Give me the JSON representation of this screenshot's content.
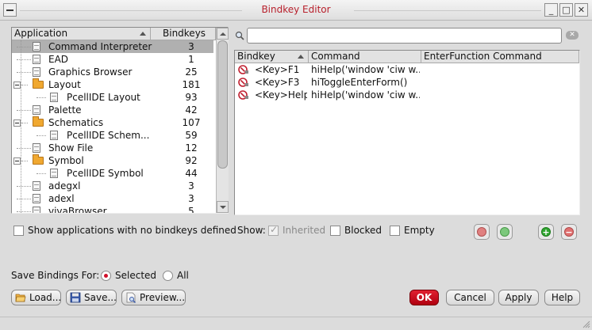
{
  "window": {
    "title": "Bindkey Editor",
    "controls": [
      "_",
      "□",
      "✕"
    ]
  },
  "app_table": {
    "headers": {
      "application": "Application",
      "bindkeys": "Bindkeys"
    },
    "rows": [
      {
        "label": "Command Interpreter",
        "count": "3",
        "type": "doc",
        "level": 0,
        "selected": true
      },
      {
        "label": "EAD",
        "count": "1",
        "type": "doc",
        "level": 0
      },
      {
        "label": "Graphics Browser",
        "count": "25",
        "type": "doc",
        "level": 0
      },
      {
        "label": "Layout",
        "count": "181",
        "type": "folder",
        "level": 0
      },
      {
        "label": "PcellIDE Layout",
        "count": "93",
        "type": "doc",
        "level": 1
      },
      {
        "label": "Palette",
        "count": "42",
        "type": "doc",
        "level": 0
      },
      {
        "label": "Schematics",
        "count": "107",
        "type": "folder",
        "level": 0
      },
      {
        "label": "PcellIDE Schem...",
        "count": "59",
        "type": "doc",
        "level": 1
      },
      {
        "label": "Show File",
        "count": "12",
        "type": "doc",
        "level": 0
      },
      {
        "label": "Symbol",
        "count": "92",
        "type": "folder",
        "level": 0
      },
      {
        "label": "PcellIDE Symbol",
        "count": "44",
        "type": "doc",
        "level": 1
      },
      {
        "label": "adegxl",
        "count": "3",
        "type": "doc",
        "level": 0
      },
      {
        "label": "adexl",
        "count": "3",
        "type": "doc",
        "level": 0
      },
      {
        "label": "vivaBrowser",
        "count": "5",
        "type": "doc",
        "level": 0
      }
    ],
    "show_empty_label": "Show applications with no bindkeys defined"
  },
  "search": {
    "value": "",
    "placeholder": ""
  },
  "binding_table": {
    "headers": {
      "bindkey": "Bindkey",
      "command": "Command",
      "enter_function": "EnterFunction Command"
    },
    "rows": [
      {
        "bindkey": "<Key>F1",
        "command": "hiHelp('window 'ciw w...",
        "enter_function": ""
      },
      {
        "bindkey": "<Key>F3",
        "command": "hiToggleEnterForm()",
        "enter_function": ""
      },
      {
        "bindkey": "<Key>Help",
        "command": "hiHelp('window 'ciw w...",
        "enter_function": ""
      }
    ]
  },
  "filters": {
    "show_label": "Show:",
    "inherited_label": "Inherited",
    "inherited_checked": true,
    "blocked_label": "Blocked",
    "empty_label": "Empty"
  },
  "save_bindings": {
    "label": "Save Bindings For:",
    "selected_label": "Selected",
    "all_label": "All"
  },
  "buttons": {
    "load": "Load...",
    "save": "Save...",
    "preview": "Preview...",
    "ok": "OK",
    "cancel": "Cancel",
    "apply": "Apply",
    "help": "Help"
  },
  "colors": {
    "title": "#b8202c",
    "ok_button": "#c81424",
    "red_indicator": "#e06060",
    "green_indicator": "#50b050",
    "add_button": "#2fa52f",
    "remove_button": "#d84a4a"
  }
}
